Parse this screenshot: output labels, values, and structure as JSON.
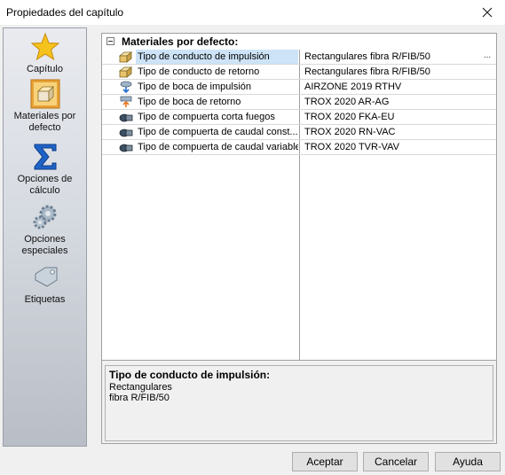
{
  "window": {
    "title": "Propiedades del capítulo"
  },
  "sidebar": {
    "items": [
      {
        "label": "Capítulo",
        "icon": "star-icon"
      },
      {
        "label": "Materiales por defecto",
        "icon": "material-box-icon"
      },
      {
        "label": "Opciones de cálculo",
        "icon": "sigma-icon"
      },
      {
        "label": "Opciones especiales",
        "icon": "gears-icon"
      },
      {
        "label": "Etiquetas",
        "icon": "tag-icon"
      }
    ],
    "selected": "Materiales por defecto"
  },
  "grid": {
    "group_title": "Materiales por defecto:",
    "rows": [
      {
        "name": "Tipo de conducto de impulsión",
        "value": "Rectangulares fibra R/FIB/50",
        "icon": "duct-supply-icon",
        "selected": true
      },
      {
        "name": "Tipo de conducto de retorno",
        "value": "Rectangulares fibra R/FIB/50",
        "icon": "duct-return-icon"
      },
      {
        "name": "Tipo de boca de impulsión",
        "value": "AIRZONE 2019 RTHV",
        "icon": "supply-outlet-icon"
      },
      {
        "name": "Tipo de boca de retorno",
        "value": "TROX 2020 AR-AG",
        "icon": "return-outlet-icon"
      },
      {
        "name": "Tipo de compuerta corta fuegos",
        "value": "TROX 2020 FKA-EU",
        "icon": "fire-damper-icon"
      },
      {
        "name": "Tipo de compuerta de caudal const...",
        "value": "TROX 2020 RN-VAC",
        "icon": "constant-flow-damper-icon"
      },
      {
        "name": "Tipo de compuerta de caudal variable",
        "value": "TROX 2020 TVR-VAV",
        "icon": "variable-flow-damper-icon"
      }
    ],
    "ellipsis": "..."
  },
  "description": {
    "title": "Tipo de conducto de impulsión:",
    "text": "Rectangulares fibra R/FIB/50"
  },
  "buttons": {
    "accept": "Aceptar",
    "cancel": "Cancelar",
    "help": "Ayuda"
  }
}
